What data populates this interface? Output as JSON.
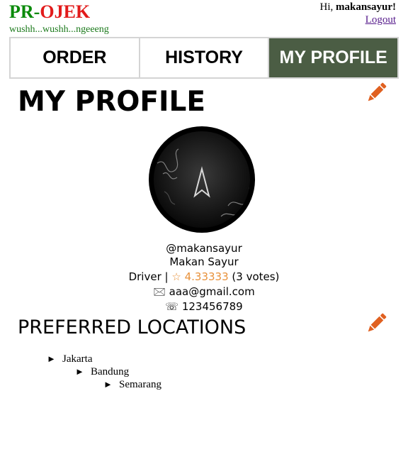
{
  "header": {
    "logo_pr": "PR",
    "logo_dash": "-",
    "logo_ojek": "OJEK",
    "tagline": "wushh...wushh...ngeeeng",
    "greeting_prefix": "Hi,",
    "username": "makansayur!",
    "logout_label": "Logout"
  },
  "tabs": [
    {
      "label": "ORDER",
      "active": false
    },
    {
      "label": "HISTORY",
      "active": false
    },
    {
      "label": "MY PROFILE",
      "active": true
    }
  ],
  "profile": {
    "title": "MY PROFILE",
    "handle": "@makansayur",
    "name": "Makan Sayur",
    "role": "Driver",
    "separator": "|",
    "rating_text": "☆ 4.33333",
    "votes_text": "(3 votes)",
    "email_icon": "🖂",
    "email": "aaa@gmail.com",
    "phone_icon": "☏",
    "phone": "123456789"
  },
  "preferred": {
    "title": "PREFERRED LOCATIONS",
    "locations": [
      "Jakarta",
      "Bandung",
      "Semarang"
    ]
  },
  "colors": {
    "active_tab": "#4b5d44",
    "logo_green": "#0a8a0a",
    "logo_red": "#e21b1b",
    "edit_orange": "#e06020",
    "rating_orange": "#e8913a"
  },
  "icons": {
    "edit": "pencil-icon",
    "email": "envelope-icon",
    "phone": "phone-icon",
    "bullet": "triangle-right-icon"
  }
}
